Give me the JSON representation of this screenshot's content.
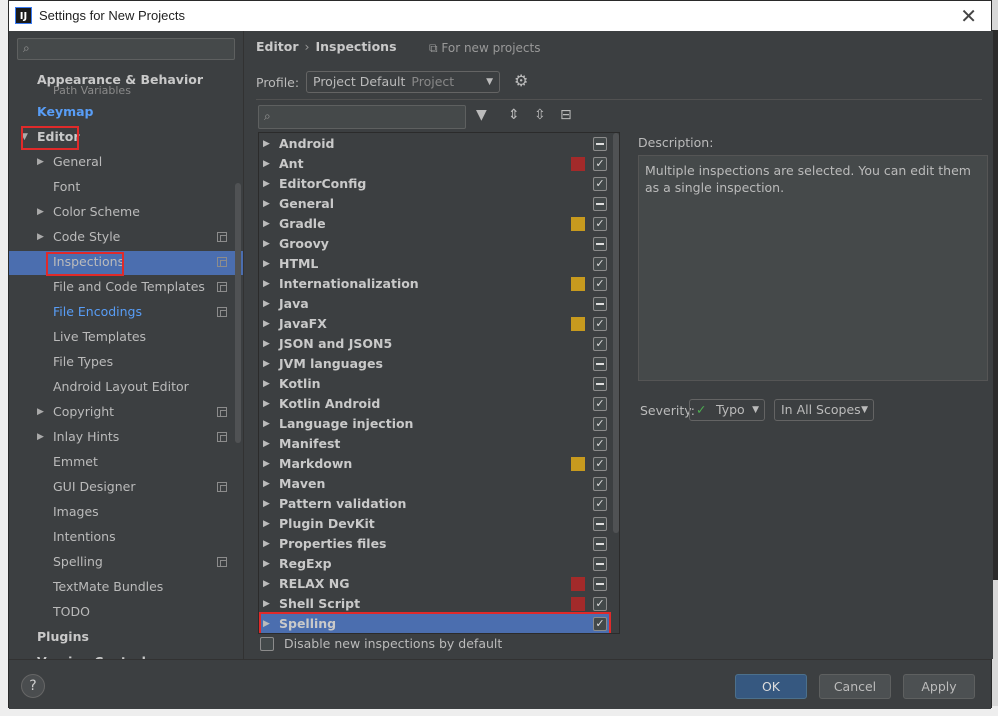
{
  "window": {
    "title": "Settings for New Projects",
    "app_icon": "IJ",
    "close_label": "✕"
  },
  "sidebar": {
    "search_placeholder": "",
    "ghost_hint": "Path Variables",
    "items": [
      {
        "label": "Appearance & Behavior",
        "level": 0
      },
      {
        "label": "Keymap",
        "level": 0
      },
      {
        "label": "Editor",
        "level": 0,
        "expanded": true
      },
      {
        "label": "General",
        "level": 1,
        "expandable": true
      },
      {
        "label": "Font",
        "level": 1
      },
      {
        "label": "Color Scheme",
        "level": 1,
        "expandable": true
      },
      {
        "label": "Code Style",
        "level": 1,
        "expandable": true,
        "copy": true
      },
      {
        "label": "Inspections",
        "level": 1,
        "copy": true,
        "selected": true
      },
      {
        "label": "File and Code Templates",
        "level": 1,
        "copy": true
      },
      {
        "label": "File Encodings",
        "level": 1,
        "copy": true
      },
      {
        "label": "Live Templates",
        "level": 1
      },
      {
        "label": "File Types",
        "level": 1
      },
      {
        "label": "Android Layout Editor",
        "level": 1
      },
      {
        "label": "Copyright",
        "level": 1,
        "expandable": true,
        "copy": true
      },
      {
        "label": "Inlay Hints",
        "level": 1,
        "expandable": true,
        "copy": true
      },
      {
        "label": "Emmet",
        "level": 1
      },
      {
        "label": "GUI Designer",
        "level": 1,
        "copy": true
      },
      {
        "label": "Images",
        "level": 1
      },
      {
        "label": "Intentions",
        "level": 1
      },
      {
        "label": "Spelling",
        "level": 1,
        "copy": true
      },
      {
        "label": "TextMate Bundles",
        "level": 1
      },
      {
        "label": "TODO",
        "level": 1
      },
      {
        "label": "Plugins",
        "level": 0
      },
      {
        "label": "Version Control",
        "level": 0
      }
    ]
  },
  "header": {
    "breadcrumb_parent": "Editor",
    "breadcrumb_sep": "›",
    "breadcrumb_current": "Inspections",
    "scope_note": "For new projects"
  },
  "profile": {
    "label": "Profile:",
    "value": "Project Default",
    "value_muted": "Project"
  },
  "inspections": [
    {
      "label": "Android",
      "severity": null,
      "state": "mixed"
    },
    {
      "label": "Ant",
      "severity": "#a32a2a",
      "state": "checked"
    },
    {
      "label": "EditorConfig",
      "severity": null,
      "state": "checked"
    },
    {
      "label": "General",
      "severity": null,
      "state": "mixed"
    },
    {
      "label": "Gradle",
      "severity": "#c79a1e",
      "state": "checked"
    },
    {
      "label": "Groovy",
      "severity": null,
      "state": "mixed"
    },
    {
      "label": "HTML",
      "severity": null,
      "state": "checked"
    },
    {
      "label": "Internationalization",
      "severity": "#c79a1e",
      "state": "checked"
    },
    {
      "label": "Java",
      "severity": null,
      "state": "mixed"
    },
    {
      "label": "JavaFX",
      "severity": "#c79a1e",
      "state": "checked"
    },
    {
      "label": "JSON and JSON5",
      "severity": null,
      "state": "checked"
    },
    {
      "label": "JVM languages",
      "severity": null,
      "state": "mixed"
    },
    {
      "label": "Kotlin",
      "severity": null,
      "state": "mixed"
    },
    {
      "label": "Kotlin Android",
      "severity": null,
      "state": "checked"
    },
    {
      "label": "Language injection",
      "severity": null,
      "state": "checked"
    },
    {
      "label": "Manifest",
      "severity": null,
      "state": "checked"
    },
    {
      "label": "Markdown",
      "severity": "#c79a1e",
      "state": "checked"
    },
    {
      "label": "Maven",
      "severity": null,
      "state": "checked"
    },
    {
      "label": "Pattern validation",
      "severity": null,
      "state": "checked"
    },
    {
      "label": "Plugin DevKit",
      "severity": null,
      "state": "mixed"
    },
    {
      "label": "Properties files",
      "severity": null,
      "state": "mixed"
    },
    {
      "label": "RegExp",
      "severity": null,
      "state": "mixed"
    },
    {
      "label": "RELAX NG",
      "severity": "#a32a2a",
      "state": "mixed"
    },
    {
      "label": "Shell Script",
      "severity": "#a32a2a",
      "state": "checked"
    },
    {
      "label": "Spelling",
      "severity": null,
      "state": "checked",
      "selected": true
    }
  ],
  "disable_new": {
    "label": "Disable new inspections by default",
    "checked": false
  },
  "description": {
    "label": "Description:",
    "text": "Multiple inspections are selected. You can edit them as a single inspection."
  },
  "severity": {
    "label": "Severity:",
    "value": "Typo",
    "scope": "In All Scopes"
  },
  "buttons": {
    "help": "?",
    "ok": "OK",
    "cancel": "Cancel",
    "apply": "Apply"
  },
  "colors": {
    "selection": "#4b6eaf",
    "link": "#589df6",
    "highlight_box": "#e02a2a"
  }
}
